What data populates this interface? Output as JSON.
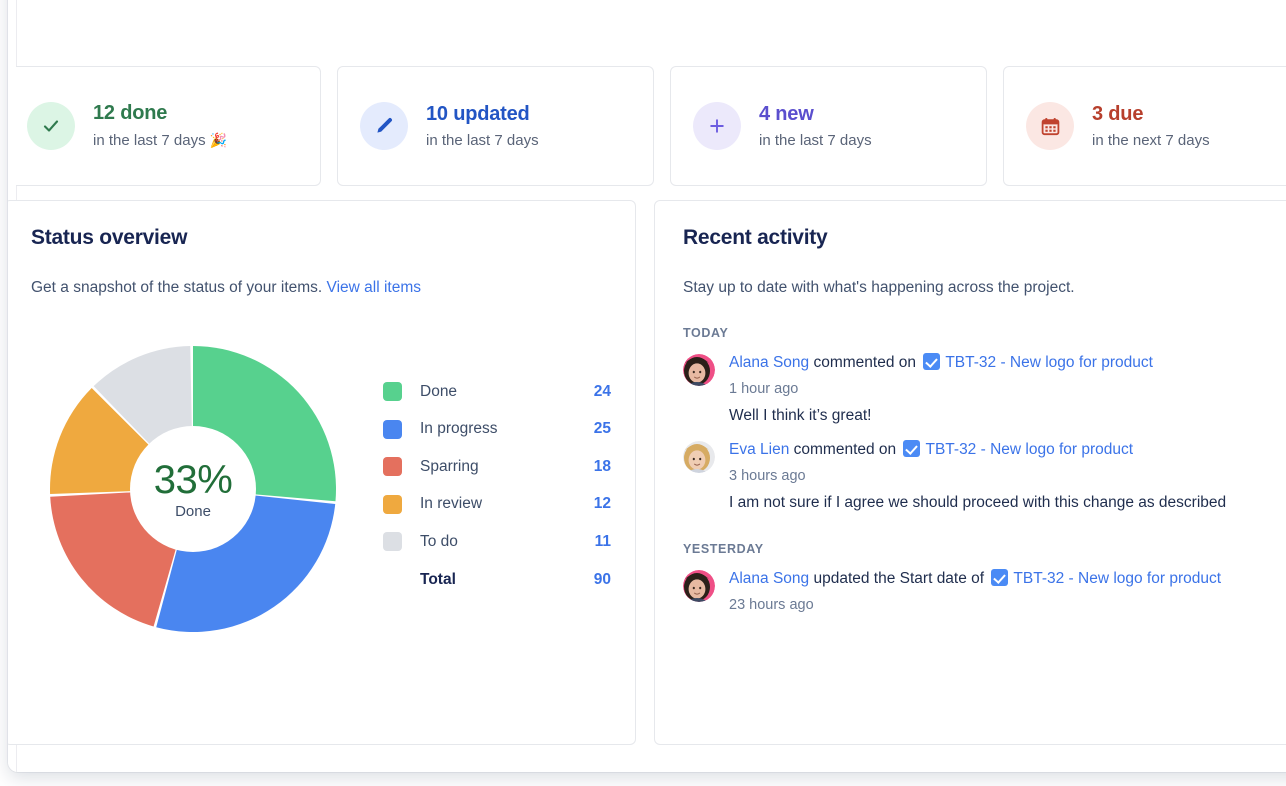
{
  "stats": [
    {
      "icon": "check-icon",
      "icon_bg": "#dcf5e5",
      "icon_color": "#2f7a4e",
      "count_label": "12 done",
      "count_color": "#2f7a4e",
      "sub": "in the last 7 days",
      "emoji": "🎉"
    },
    {
      "icon": "pencil-icon",
      "icon_bg": "#e4ebfd",
      "icon_color": "#2255c4",
      "count_label": "10 updated",
      "count_color": "#2255c4",
      "sub": "in the last 7 days",
      "emoji": ""
    },
    {
      "icon": "plus-icon",
      "icon_bg": "#ece9fb",
      "icon_color": "#6c5ce0",
      "count_label": "4 new",
      "count_color": "#5b4fce",
      "sub": "in the last 7 days",
      "emoji": ""
    },
    {
      "icon": "calendar-icon",
      "icon_bg": "#fbe7e3",
      "icon_color": "#c0432f",
      "count_label": "3 due",
      "count_color": "#b73f2c",
      "sub": "in the next 7 days",
      "emoji": ""
    }
  ],
  "status_overview": {
    "title": "Status overview",
    "description": "Get a snapshot of the status of your items.",
    "link_label": "View all items",
    "total_label": "Total"
  },
  "chart_data": {
    "type": "pie",
    "title": "Status overview",
    "center_value": "33%",
    "center_label": "Done",
    "total": 90,
    "total_label": "Total",
    "legend_position": "right",
    "categories": [
      "Done",
      "In progress",
      "Sparring",
      "In review",
      "To do"
    ],
    "values": [
      24,
      25,
      18,
      12,
      11
    ],
    "colors": [
      "#57d18e",
      "#4a86f0",
      "#e4705e",
      "#efa93f",
      "#dcdfe4"
    ],
    "slices": [
      {
        "label": "Done",
        "value": 24,
        "color": "#57d18e"
      },
      {
        "label": "In progress",
        "value": 25,
        "color": "#4a86f0"
      },
      {
        "label": "Sparring",
        "value": 18,
        "color": "#e4705e"
      },
      {
        "label": "In review",
        "value": 12,
        "color": "#efa93f"
      },
      {
        "label": "To do",
        "value": 11,
        "color": "#dcdfe4"
      }
    ]
  },
  "recent_activity": {
    "title": "Recent activity",
    "description": "Stay up to date with what's happening across the project.",
    "groups": [
      {
        "label": "TODAY",
        "items": [
          {
            "avatar": "alana-song-avatar",
            "user": "Alana Song",
            "action": "commented on",
            "issue": "TBT-32 - New logo for product",
            "time": "1 hour ago",
            "comment": "Well I think it’s great!"
          },
          {
            "avatar": "eva-lien-avatar",
            "user": "Eva Lien",
            "action": "commented on",
            "issue": "TBT-32 - New logo for product",
            "time": "3 hours ago",
            "comment": "I am not sure if I agree we should proceed with this change as described"
          }
        ]
      },
      {
        "label": "YESTERDAY",
        "items": [
          {
            "avatar": "alana-song-avatar",
            "user": "Alana Song",
            "action": "updated the Start date of",
            "issue": "TBT-32 - New logo for product",
            "time": "23 hours ago",
            "comment": ""
          }
        ]
      }
    ]
  }
}
